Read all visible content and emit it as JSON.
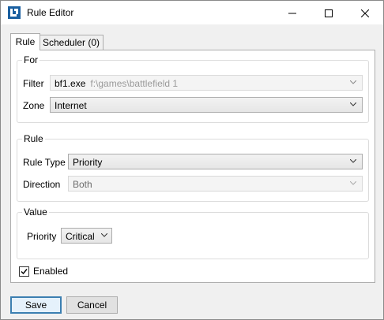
{
  "window": {
    "title": "Rule Editor"
  },
  "tabs": [
    {
      "label": "Rule"
    },
    {
      "label": "Scheduler (0)"
    }
  ],
  "for_group": {
    "title": "For",
    "filter": {
      "label": "Filter",
      "exe": "bf1.exe",
      "path": "f:\\games\\battlefield 1"
    },
    "zone": {
      "label": "Zone",
      "value": "Internet"
    }
  },
  "rule_group": {
    "title": "Rule",
    "rule_type": {
      "label": "Rule Type",
      "value": "Priority"
    },
    "direction": {
      "label": "Direction",
      "value": "Both"
    }
  },
  "value_group": {
    "title": "Value",
    "priority": {
      "label": "Priority",
      "value": "Critical"
    }
  },
  "enabled": {
    "label": "Enabled",
    "checked": true
  },
  "buttons": {
    "save": "Save",
    "cancel": "Cancel"
  },
  "icons": {
    "app": "app-logo-icon",
    "minimize": "minimize-icon",
    "maximize": "maximize-icon",
    "close": "close-icon",
    "dropdown": "chevron-down-icon",
    "check": "checkmark-icon"
  },
  "colors": {
    "accent": "#3c7fb1",
    "app_icon": "#1a5fa0"
  }
}
